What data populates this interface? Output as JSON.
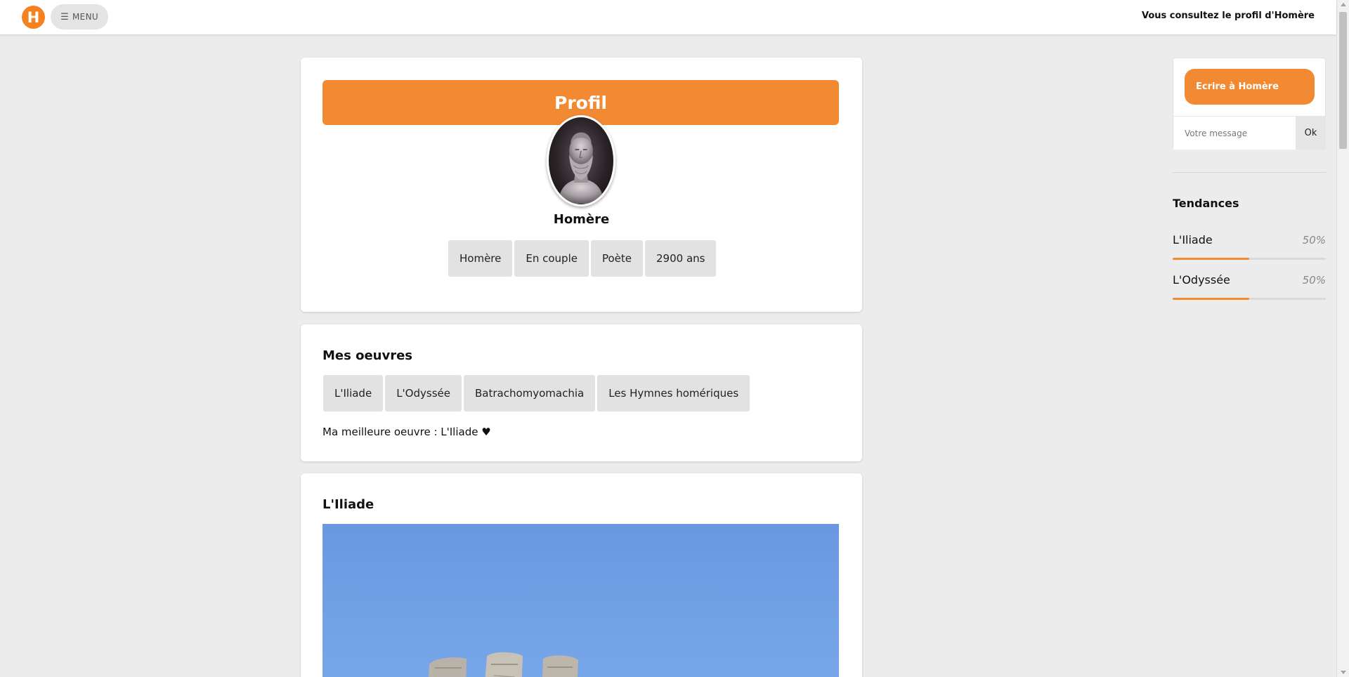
{
  "topbar": {
    "logo_letter": "H",
    "menu_icon": "hamburger-icon",
    "menu_label": "MENU",
    "viewing_text": "Vous consultez le profil d'Homère"
  },
  "profile": {
    "header": "Profil",
    "name": "Homère",
    "chips": [
      "Homère",
      "En couple",
      "Poète",
      "2900 ans"
    ]
  },
  "works": {
    "title": "Mes oeuvres",
    "chips": [
      "L'Iliade",
      "L'Odyssée",
      "Batrachomyomachia",
      "Les Hymnes homériques"
    ],
    "best": "Ma meilleure oeuvre : L'Iliade ♥"
  },
  "iliad_section": {
    "title": "L'Iliade"
  },
  "messaging": {
    "write_label": "Ecrire à Homère",
    "input_placeholder": "Votre message",
    "ok_label": "Ok"
  },
  "trends": {
    "title": "Tendances",
    "items": [
      {
        "label": "L'Iliade",
        "percent_text": "50%",
        "fraction": 0.5
      },
      {
        "label": "L'Odyssée",
        "percent_text": "50%",
        "fraction": 0.5
      }
    ]
  },
  "colors": {
    "accent": "#f28a33",
    "logo": "#f58220",
    "background": "#ececec"
  }
}
